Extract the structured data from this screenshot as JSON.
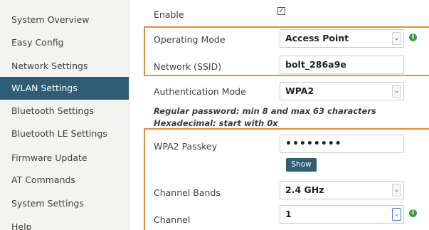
{
  "sidebar": {
    "items": [
      {
        "label": "System Overview"
      },
      {
        "label": "Easy Config"
      },
      {
        "label": "Network Settings"
      },
      {
        "label": "WLAN Settings",
        "active": true
      },
      {
        "label": "Bluetooth Settings"
      },
      {
        "label": "Bluetooth LE Settings"
      },
      {
        "label": "Firmware Update"
      },
      {
        "label": "AT Commands"
      },
      {
        "label": "System Settings"
      },
      {
        "label": "Help"
      }
    ]
  },
  "form": {
    "enable": {
      "label": "Enable",
      "checked": true,
      "mark": "✓"
    },
    "operating_mode": {
      "label": "Operating Mode",
      "value": "Access Point"
    },
    "ssid": {
      "label": "Network (SSID)",
      "value": "bolt_286a9e"
    },
    "auth_mode": {
      "label": "Authentication Mode",
      "value": "WPA2"
    },
    "hint_line1": "Regular password: min 8 and max 63 characters",
    "hint_line2": "Hexadecimal: start with 0x",
    "passkey": {
      "label": "WPA2 Passkey",
      "value": "••••••••"
    },
    "show_button": "Show",
    "channel_bands": {
      "label": "Channel Bands",
      "value": "2.4 GHz"
    },
    "channel": {
      "label": "Channel",
      "value": "1"
    }
  },
  "icons": {
    "dropdown_arrow": "⌄",
    "info": "i"
  },
  "colors": {
    "sidebar_active": "#2f5d75",
    "highlight_box": "#e98b3a",
    "info_icon": "#3e9e3c",
    "button": "#2f5d75"
  }
}
